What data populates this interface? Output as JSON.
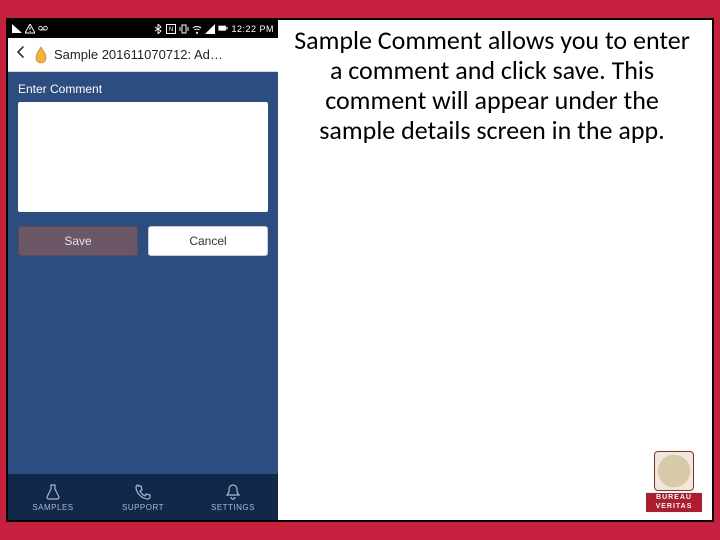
{
  "statusbar": {
    "time": "12:22 PM"
  },
  "appbar": {
    "title": "Sample 201611070712: Ad…"
  },
  "form": {
    "label": "Enter Comment",
    "value": ""
  },
  "buttons": {
    "save": "Save",
    "cancel": "Cancel"
  },
  "nav": {
    "samples": "SAMPLES",
    "support": "SUPPORT",
    "settings": "SETTINGS"
  },
  "explainer": "Sample Comment allows you to enter a comment and click save. This comment will appear under the sample details screen in the app.",
  "logo": {
    "line1": "BUREAU",
    "line2": "VERITAS"
  }
}
